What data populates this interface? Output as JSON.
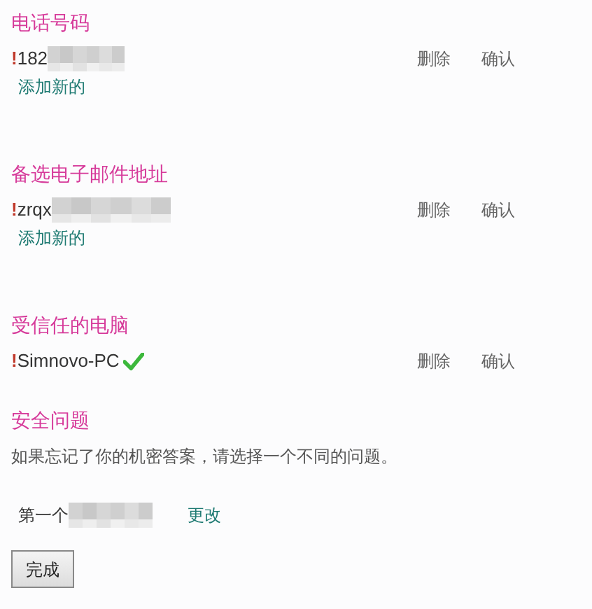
{
  "sections": [
    {
      "kind": "list",
      "title": "电话号码",
      "items": [
        {
          "marker": "!",
          "value": "182",
          "blurred": true,
          "verified": false,
          "actions": [
            "删除",
            "确认"
          ]
        }
      ],
      "add_link": "添加新的"
    },
    {
      "kind": "list",
      "title": "备选电子邮件地址",
      "items": [
        {
          "marker": "!",
          "value": "zrqx",
          "blurred": true,
          "verified": false,
          "actions": [
            "删除",
            "确认"
          ]
        }
      ],
      "add_link": "添加新的"
    },
    {
      "kind": "list",
      "title": "受信任的电脑",
      "items": [
        {
          "marker": "!",
          "value": "Simnovo-PC",
          "blurred": false,
          "verified": true,
          "actions": [
            "删除",
            "确认"
          ]
        }
      ]
    },
    {
      "kind": "question",
      "title": "安全问题",
      "description": "如果忘记了你的机密答案，请选择一个不同的问题。",
      "question_label": "第一个",
      "change_link": "更改"
    }
  ],
  "done_button": "完成"
}
